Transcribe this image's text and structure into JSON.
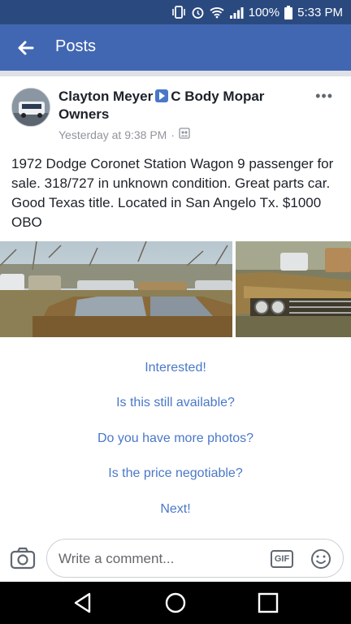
{
  "status_bar": {
    "battery": "100%",
    "time": "5:33 PM"
  },
  "app_bar": {
    "title": "Posts",
    "back_icon": "arrow-left-icon"
  },
  "post": {
    "author": "Clayton Meyer",
    "group": "C Body Mopar Owners",
    "timestamp": "Yesterday at 9:38 PM",
    "separator": "·",
    "privacy_icon": "group-icon",
    "text": "1972 Dodge Coronet Station Wagon 9 passenger for sale. 318/727 in unknown condition. Great parts car. Good Texas title. Located in San Angelo Tx. $1000 OBO",
    "more_label": "•••",
    "photos": [
      "junkyard-wagon-photo",
      "car-front-grille-photo"
    ]
  },
  "quick_replies": [
    "Interested!",
    "Is this still available?",
    "Do you have more photos?",
    "Is the price negotiable?",
    "Next!"
  ],
  "composer": {
    "placeholder": "Write a comment...",
    "gif_label": "GIF"
  },
  "colors": {
    "app_bar": "#4267b2",
    "status_bar": "#2a4a7f",
    "link": "#4a78c8"
  }
}
